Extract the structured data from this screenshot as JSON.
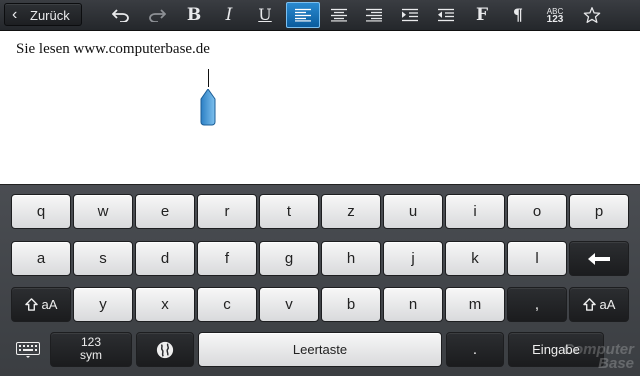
{
  "toolbar": {
    "back_label": "Zurück",
    "bold_glyph": "B",
    "italic_glyph": "I",
    "underline_glyph": "U",
    "font_glyph": "F",
    "paragraph_glyph": "¶",
    "abc_line1": "ABC",
    "abc_line2": "123",
    "icons": [
      "back-chevron-icon",
      "undo-icon",
      "redo-icon",
      "bold-icon",
      "italic-icon",
      "underline-icon",
      "align-left-icon",
      "align-center-icon",
      "align-right-icon",
      "indent-increase-icon",
      "indent-decrease-icon",
      "font-icon",
      "paragraph-icon",
      "spellcheck-abc-icon",
      "star-icon"
    ],
    "active_color": "#0a6fbf"
  },
  "document": {
    "text": "Sie lesen www.computerbase.de"
  },
  "keyboard": {
    "row1": [
      "q",
      "w",
      "e",
      "r",
      "t",
      "z",
      "u",
      "i",
      "o",
      "p"
    ],
    "row2": [
      "a",
      "s",
      "d",
      "f",
      "g",
      "h",
      "j",
      "k",
      "l"
    ],
    "row3": [
      "y",
      "x",
      "c",
      "v",
      "b",
      "n",
      "m",
      ","
    ],
    "shift_label": "aA",
    "sym_line1": "123",
    "sym_line2": "sym",
    "space_label": "Leertaste",
    "period_label": ".",
    "enter_label": "Eingabe"
  },
  "watermark": {
    "line1": "Computer",
    "line2": "Base"
  }
}
